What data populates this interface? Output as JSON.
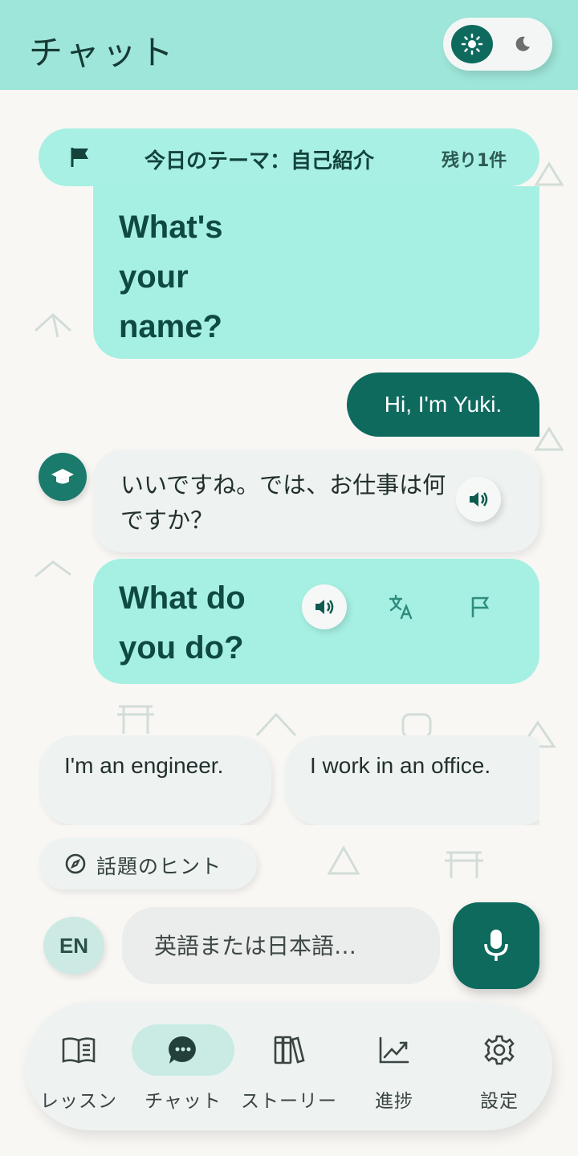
{
  "header": {
    "title": "チャット",
    "theme_toggle": {
      "light_icon": "sun-icon",
      "dark_icon": "moon-icon",
      "selected": "light"
    }
  },
  "topic_banner": {
    "icon": "flag-icon",
    "title": "今日のテーマ：自己紹介",
    "remaining": "残り1件"
  },
  "messages": [
    {
      "role": "tutor",
      "lang": "en",
      "text": "What's your name?"
    },
    {
      "role": "user",
      "text": "Hi, I'm Yuki."
    },
    {
      "role": "tutor",
      "lang": "ja",
      "text": "いいですね。では、お仕事は何ですか？",
      "icon": "speaker-icon"
    },
    {
      "role": "tutor",
      "lang": "en",
      "text": "What do you do?",
      "icons": [
        "speaker-icon",
        "translate-icon",
        "flag-outline-icon"
      ]
    }
  ],
  "suggestions": [
    "I'm an engineer.",
    "I work in an office."
  ],
  "hint_chip": {
    "icon": "compass-icon",
    "label": "話題のヒント"
  },
  "composer": {
    "language": "EN",
    "placeholder": "英語または日本語…",
    "mic_icon": "mic-icon"
  },
  "bottom_nav": {
    "items": [
      {
        "label": "レッスン",
        "icon": "book-icon"
      },
      {
        "label": "チャット",
        "icon": "chat-icon",
        "active": true
      },
      {
        "label": "ストーリー",
        "icon": "books-icon"
      },
      {
        "label": "進捗",
        "icon": "trend-icon"
      },
      {
        "label": "設定",
        "icon": "gear-icon"
      }
    ]
  },
  "colors": {
    "header_bg": "#9ee6d9",
    "accent": "#0f6a5e",
    "tutor_bubble": "#a6f0e3",
    "background": "#f9f7f4"
  }
}
